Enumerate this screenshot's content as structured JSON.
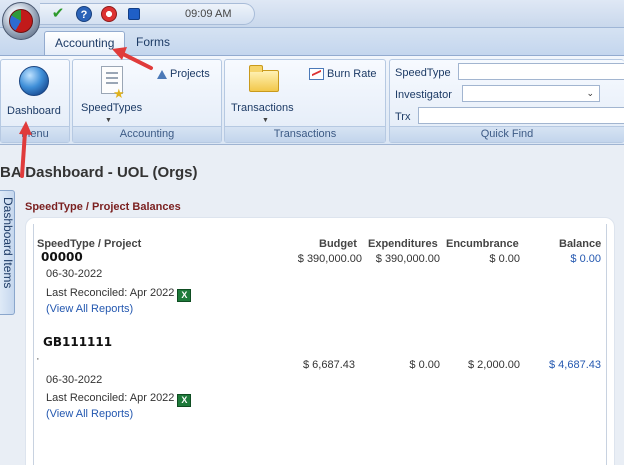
{
  "quick_access": {
    "time": "09:09 AM",
    "help_glyph": "?"
  },
  "tabs": [
    {
      "label": "Accounting"
    },
    {
      "label": "Forms"
    }
  ],
  "ribbon": {
    "menu_group": {
      "dashboard_label": "Dashboard",
      "group_label": "Menu"
    },
    "accounting_group": {
      "speedtypes_label": "SpeedTypes",
      "projects_label": "Projects",
      "group_label": "Accounting"
    },
    "transactions_group": {
      "transactions_label": "Transactions",
      "burnrate_label": "Burn Rate",
      "group_label": "Transactions"
    },
    "quickfind_group": {
      "speedtype_label": "SpeedType",
      "investigator_label": "Investigator",
      "trx_label": "Trx",
      "group_label": "Quick Find"
    }
  },
  "page": {
    "title": "BA Dashboard - UOL (Orgs)",
    "side_tab": "Dashboard Items",
    "section_title": "SpeedType / Project Balances"
  },
  "table": {
    "headers": {
      "speedtype": "SpeedType / Project",
      "budget": "Budget",
      "expenditures": "Expenditures",
      "encumbrance": "Encumbrance",
      "balance": "Balance"
    },
    "rows": [
      {
        "name": "00000",
        "date": "06-30-2022",
        "reconciled": "Last Reconciled: Apr 2022",
        "reports_link": "(View All Reports)",
        "budget": "$ 390,000.00",
        "expenditures": "$ 390,000.00",
        "encumbrance": "$ 0.00",
        "balance": "$ 0.00"
      },
      {
        "name": "GB111111",
        "date": "06-30-2022",
        "reconciled": "Last Reconciled: Apr 2022",
        "reports_link": "(View All Reports)",
        "budget": "$ 6,687.43",
        "expenditures": "$ 0.00",
        "encumbrance": "$ 2,000.00",
        "balance": "$ 4,687.43"
      }
    ]
  },
  "colors": {
    "annotation_arrow": "#e03b3b",
    "link": "#2458b0",
    "section_title": "#7a1f1f"
  }
}
